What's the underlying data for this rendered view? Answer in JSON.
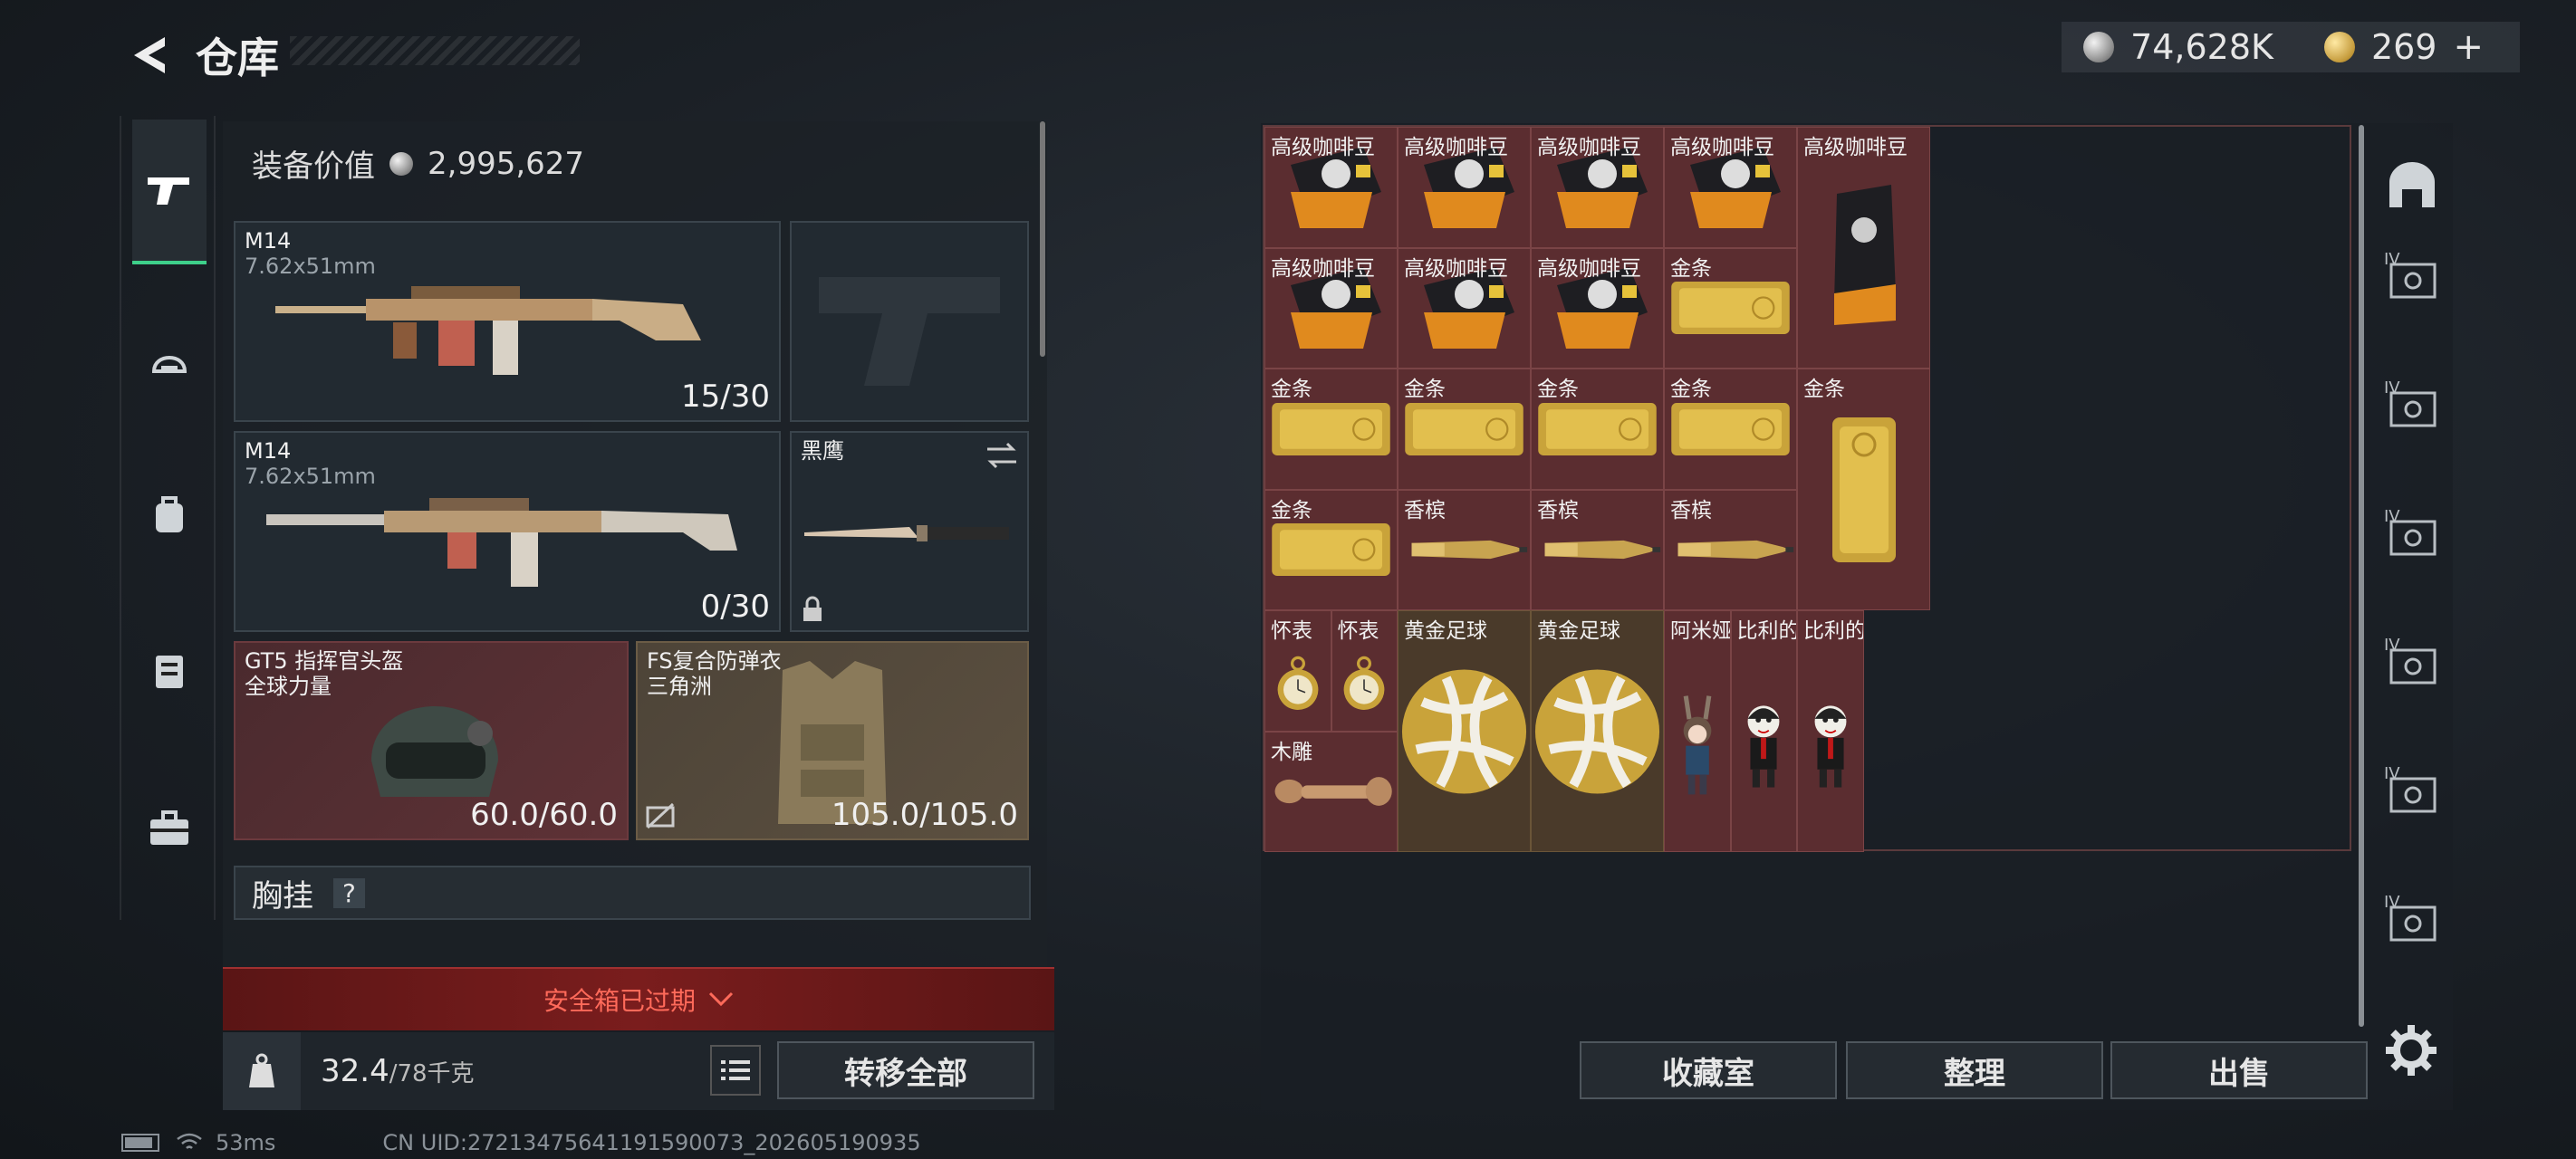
{
  "header": {
    "title": "仓库",
    "silver": "74,628K",
    "gold": "269",
    "gold_plus": "+"
  },
  "equipment": {
    "value_label": "装备价值",
    "value": "2,995,627",
    "primary1": {
      "name": "M14",
      "caliber": "7.62x51mm",
      "ammo": "15/30"
    },
    "primary2": {
      "name": "M14",
      "caliber": "7.62x51mm",
      "ammo": "0/30"
    },
    "melee": {
      "name": "黑鹰"
    },
    "helmet": {
      "name": "GT5 指挥官头盔",
      "sub": "全球力量",
      "durability": "60.0/60.0"
    },
    "armor": {
      "name": "FS复合防弹衣",
      "sub": "三角洲",
      "durability": "105.0/105.0"
    },
    "chest_rig": {
      "label": "胸挂",
      "help": "?"
    },
    "safebox": "安全箱已过期",
    "weight": "32.4",
    "weight_max": "/78千克",
    "transfer_all": "转移全部"
  },
  "warehouse": {
    "items": [
      {
        "label": "高级咖啡豆",
        "kind": "coffee"
      },
      {
        "label": "高级咖啡豆",
        "kind": "coffee"
      },
      {
        "label": "高级咖啡豆",
        "kind": "coffee"
      },
      {
        "label": "高级咖啡豆",
        "kind": "coffee"
      },
      {
        "label": "高级咖啡豆",
        "kind": "coffee-tall"
      },
      {
        "label": "高级咖啡豆",
        "kind": "coffee"
      },
      {
        "label": "高级咖啡豆",
        "kind": "coffee"
      },
      {
        "label": "高级咖啡豆",
        "kind": "coffee"
      },
      {
        "label": "金条",
        "kind": "gold"
      },
      {
        "label": "金条",
        "kind": "gold"
      },
      {
        "label": "金条",
        "kind": "gold"
      },
      {
        "label": "金条",
        "kind": "gold"
      },
      {
        "label": "金条",
        "kind": "gold"
      },
      {
        "label": "金条",
        "kind": "gold-tall"
      },
      {
        "label": "金条",
        "kind": "gold"
      },
      {
        "label": "香槟",
        "kind": "champagne"
      },
      {
        "label": "香槟",
        "kind": "champagne"
      },
      {
        "label": "香槟",
        "kind": "champagne"
      },
      {
        "label": "怀表",
        "kind": "watch"
      },
      {
        "label": "怀表",
        "kind": "watch"
      },
      {
        "label": "黄金足球",
        "kind": "ball"
      },
      {
        "label": "黄金足球",
        "kind": "ball"
      },
      {
        "label": "阿米娅（…",
        "kind": "figure"
      },
      {
        "label": "比利的面…",
        "kind": "puppet"
      },
      {
        "label": "比利的面…",
        "kind": "puppet"
      },
      {
        "label": "木雕",
        "kind": "carving"
      }
    ],
    "buttons": {
      "collection": "收藏室",
      "sort": "整理",
      "sell": "出售"
    },
    "side_tags": [
      "IV",
      "IV",
      "IV",
      "IV",
      "IV",
      "IV"
    ]
  },
  "status": {
    "ping": "53ms",
    "uid": "CN UID:27213475641191590073_202605190935"
  }
}
